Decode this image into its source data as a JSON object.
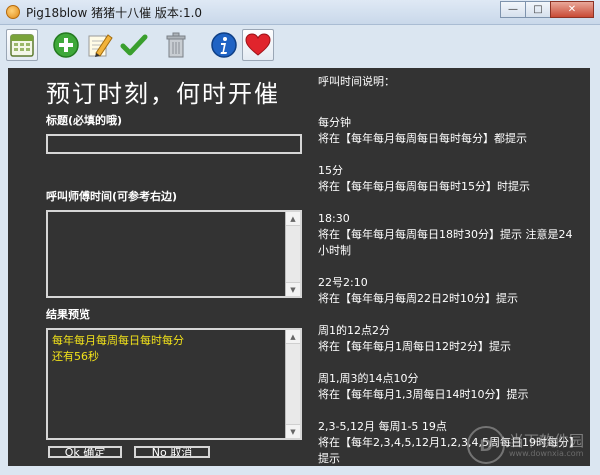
{
  "window": {
    "title": "Pig18blow 猪猪十八催 版本:1.0",
    "buttons": [
      "—",
      "□",
      "✕"
    ]
  },
  "toolbar": {
    "icons": [
      "calendar-icon",
      "add-icon",
      "edit-icon",
      "checkmark-icon",
      "trash-icon",
      "info-icon",
      "heart-icon"
    ]
  },
  "form": {
    "heading": "预订时刻，何时开催",
    "title_label": "标题(必填的哦)",
    "title_value": "",
    "time_label": "呼叫师傅时间(可参考右边)",
    "preview_label": "结果预览",
    "preview_lines": [
      "每年每月每周每日每时每分",
      "还有56秒"
    ],
    "ok_label": "Ok 确定",
    "cancel_label": "No 取消"
  },
  "help": {
    "title": "呼叫时间说明：",
    "entries": [
      {
        "input": "每分钟",
        "desc": "将在【每年每月每周每日每时每分】都提示"
      },
      {
        "input": "15分",
        "desc": "将在【每年每月每周每日每时15分】时提示"
      },
      {
        "input": "18:30",
        "desc": "将在【每年每月每周每日18时30分】提示 注意是24小时制"
      },
      {
        "input": "22号2:10",
        "desc": "将在【每年每月每周22日2时10分】提示"
      },
      {
        "input": "周1的12点2分",
        "desc": "将在【每年每月1周每日12时2分】提示"
      },
      {
        "input": "周1,周3的14点10分",
        "desc": "将在【每年每月1,3周每日14时10分】提示"
      },
      {
        "input": "2,3-5,12月 每周1-5 19点",
        "desc": "将在【每年2,3,4,5,12月1,2,3,4,5周每日19时每分】提示"
      }
    ]
  },
  "watermark": {
    "text": "当下软件园",
    "sub": "www.downxia.com"
  }
}
